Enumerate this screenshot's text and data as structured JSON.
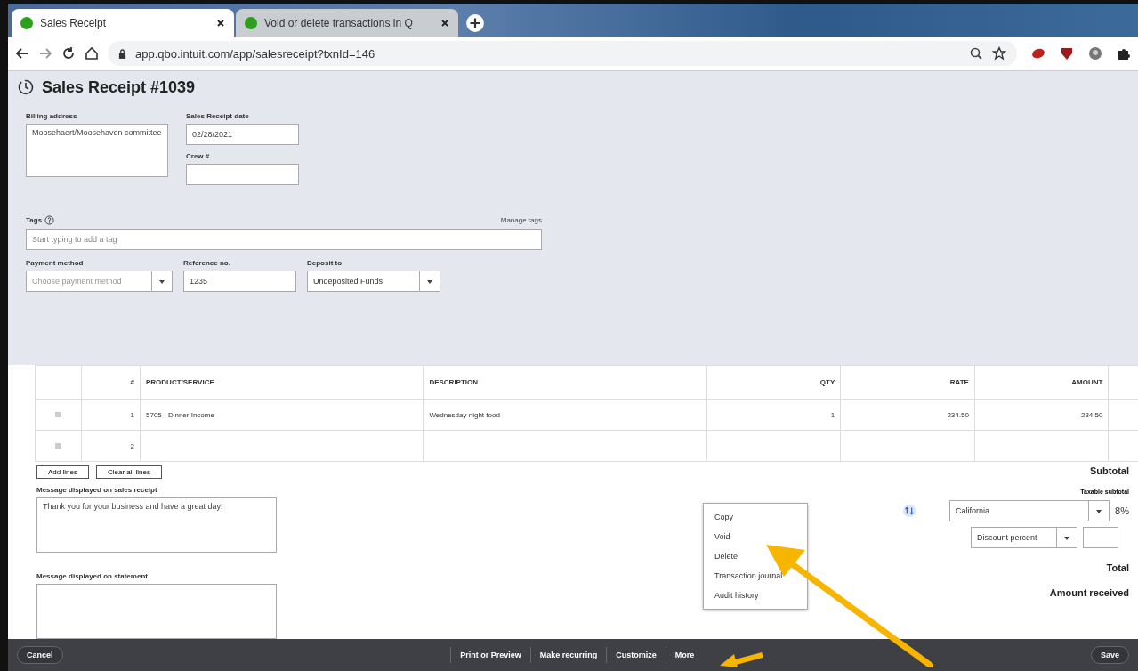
{
  "browser": {
    "tabs": [
      {
        "title": "Sales Receipt",
        "selected": true
      },
      {
        "title": "Void or delete transactions in Q",
        "selected": false
      }
    ],
    "url": "app.qbo.intuit.com/app/salesreceipt?txnId=146"
  },
  "page_title": "Sales Receipt #1039",
  "form": {
    "billing_address": {
      "label": "Billing address",
      "value": "Moosehaert/Moosehaven committee"
    },
    "date": {
      "label": "Sales Receipt date",
      "value": "02/28/2021"
    },
    "crew": {
      "label": "Crew #"
    },
    "tags": {
      "label": "Tags",
      "manage": "Manage tags",
      "placeholder": "Start typing to add a tag"
    },
    "payment_method": {
      "label": "Payment method",
      "placeholder": "Choose payment method"
    },
    "reference": {
      "label": "Reference no.",
      "value": "1235"
    },
    "deposit_to": {
      "label": "Deposit to",
      "value": "Undeposited Funds"
    }
  },
  "table": {
    "columns": [
      "#",
      "PRODUCT/SERVICE",
      "DESCRIPTION",
      "QTY",
      "RATE",
      "AMOUNT"
    ],
    "rows": [
      [
        "1",
        "5705 - Dinner Income",
        "Wednesday night food",
        "1",
        "234.50",
        "234.50"
      ],
      [
        "2",
        "",
        "",
        "",
        "",
        ""
      ]
    ]
  },
  "line_buttons": [
    "Add lines",
    "Clear all lines"
  ],
  "messages": [
    {
      "label": "Message displayed on sales receipt",
      "value": "Thank you for your business and have a great day!"
    },
    {
      "label": "Message displayed on statement"
    }
  ],
  "totals": {
    "subtotal": "Subtotal",
    "taxable_subtotal": "Taxable subtotal",
    "tax_rate_select": "California",
    "tax_percent": "8%",
    "discount_select": "Discount percent",
    "total": "Total",
    "amount_received": "Amount received"
  },
  "more_menu": [
    "Copy",
    "Void",
    "Delete",
    "Transaction journal",
    "Audit history"
  ],
  "footer": {
    "left": "Cancel",
    "center": [
      "Print or Preview",
      "Make recurring",
      "Customize",
      "More"
    ],
    "right": "Save"
  }
}
